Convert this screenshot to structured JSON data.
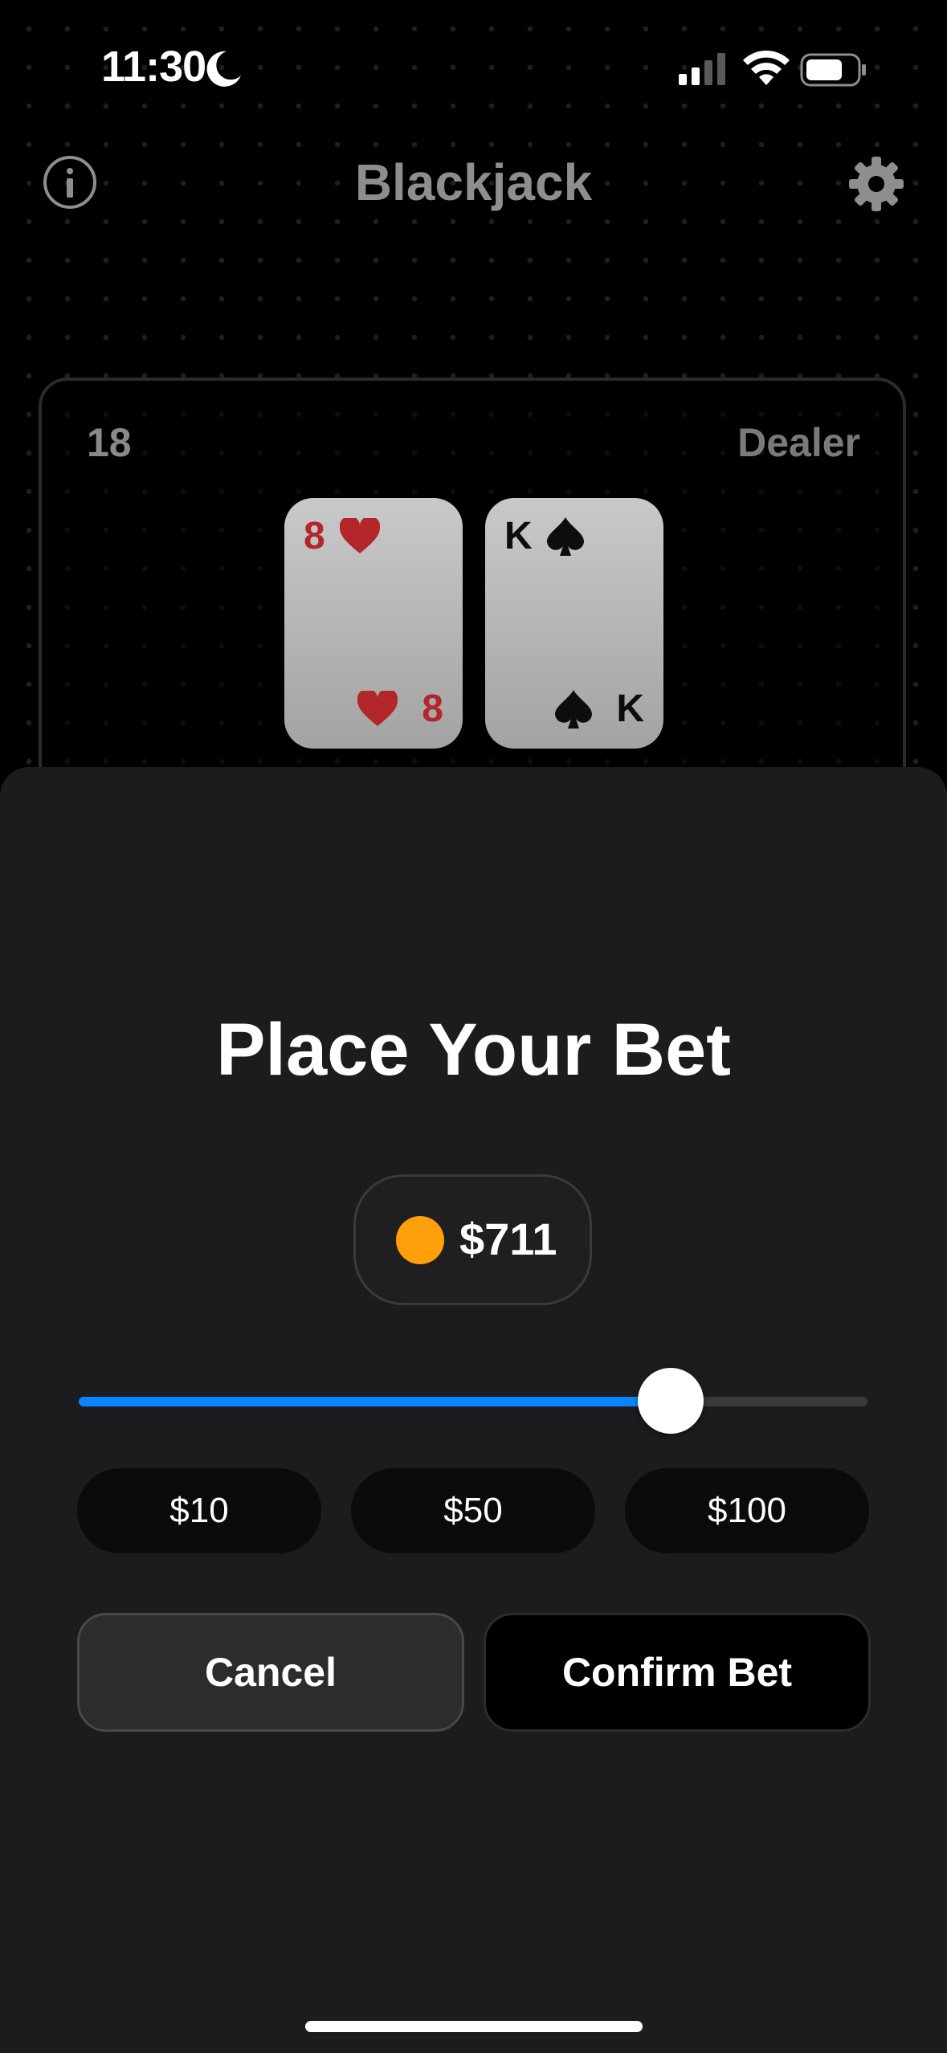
{
  "status_bar": {
    "time": "11:30",
    "icons": [
      "moon-icon",
      "signal-icon",
      "wifi-icon",
      "battery-icon"
    ]
  },
  "header": {
    "title": "Blackjack",
    "left_icon": "info-icon",
    "right_icon": "gear-icon"
  },
  "dealer": {
    "score": "18",
    "label": "Dealer",
    "cards": [
      {
        "rank": "8",
        "suit": "heart",
        "color": "#b3262a"
      },
      {
        "rank": "K",
        "suit": "spade",
        "color": "#0d0d0d"
      }
    ]
  },
  "bet_sheet": {
    "title": "Place Your Bet",
    "balance": "$711",
    "coin_color": "#ff9f0a",
    "slider_fraction": 0.75,
    "accent_color": "#0a84ff",
    "quick_bets": [
      "$10",
      "$50",
      "$100"
    ],
    "cancel_label": "Cancel",
    "confirm_label": "Confirm Bet"
  }
}
